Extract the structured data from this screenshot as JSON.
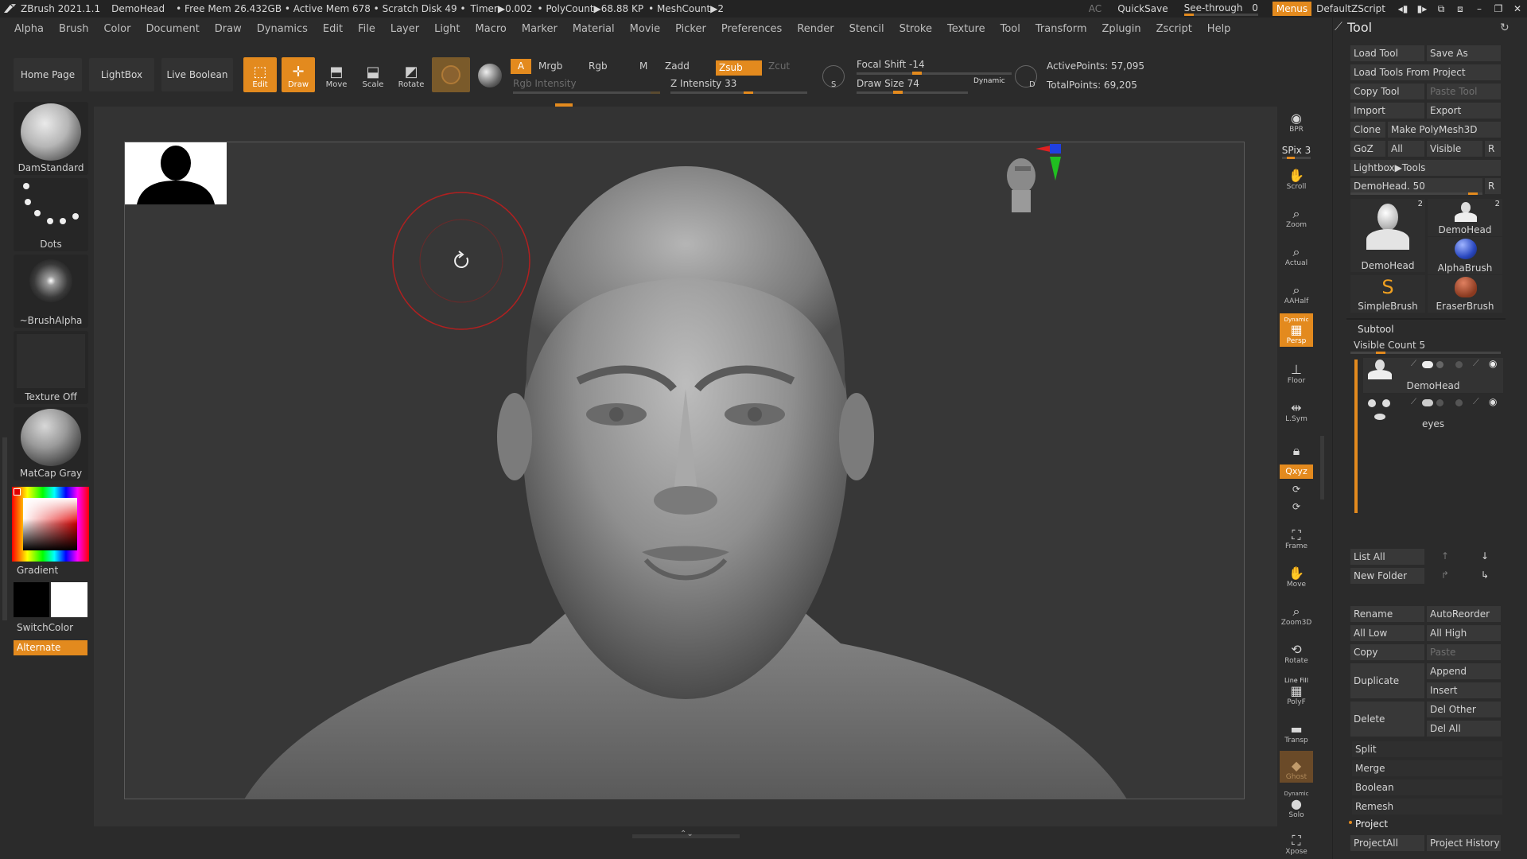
{
  "titlebar": {
    "app": "ZBrush 2021.1.1",
    "doc": "DemoHead",
    "stats": "• Free Mem 26.432GB • Active Mem 678 • Scratch Disk 49 •",
    "timer": "Timer▶0.002",
    "polycount": "• PolyCount▶68.88 KP",
    "meshcount": "• MeshCount▶2",
    "ac": "AC",
    "quicksave": "QuickSave",
    "see_through_label": "See-through",
    "see_through_value": "0",
    "menus": "Menus",
    "script": "DefaultZScript"
  },
  "menu": [
    "Alpha",
    "Brush",
    "Color",
    "Document",
    "Draw",
    "Dynamics",
    "Edit",
    "File",
    "Layer",
    "Light",
    "Macro",
    "Marker",
    "Material",
    "Movie",
    "Picker",
    "Preferences",
    "Render",
    "Stencil",
    "Stroke",
    "Texture",
    "Tool",
    "Transform",
    "Zplugin",
    "Zscript",
    "Help"
  ],
  "shelf": {
    "home_page": "Home Page",
    "lightbox": "LightBox",
    "live_boolean": "Live Boolean",
    "edit": "Edit",
    "draw": "Draw",
    "move": "Move",
    "scale": "Scale",
    "rotate": "Rotate",
    "a": "A",
    "mrgb": "Mrgb",
    "rgb": "Rgb",
    "m": "M",
    "zadd": "Zadd",
    "zsub": "Zsub",
    "zcut": "Zcut",
    "rgb_intensity": "Rgb Intensity",
    "z_intensity": "Z Intensity 33",
    "focal_shift": "Focal Shift -14",
    "draw_size": "Draw Size 74",
    "dynamic": "Dynamic",
    "active_points": "ActivePoints: 57,095",
    "total_points": "TotalPoints: 69,205",
    "s": "S",
    "d": "D",
    "values": {
      "z_intensity": 33,
      "focal_shift": -14,
      "draw_size": 74
    }
  },
  "left": {
    "brush": "DamStandard",
    "stroke": "Dots",
    "alpha": "~BrushAlpha",
    "texture": "Texture Off",
    "material": "MatCap Gray",
    "gradient": "Gradient",
    "switchcolor": "SwitchColor",
    "alternate": "Alternate"
  },
  "rightbar": {
    "bpr": "BPR",
    "spix": "SPix 3",
    "scroll": "Scroll",
    "zoom": "Zoom",
    "actual": "Actual",
    "aahalf": "AAHalf",
    "persp": "Persp",
    "dynamic": "Dynamic",
    "floor": "Floor",
    "lsym": "L.Sym",
    "xyz": "Qxyz",
    "frame": "Frame",
    "move": "Move",
    "zoom3d": "Zoom3D",
    "rotate": "Rotate",
    "linefill": "Line Fill",
    "polyf": "PolyF",
    "transp": "Transp",
    "ghost": "Ghost",
    "solo": "Solo",
    "xpose": "Xpose"
  },
  "tool": {
    "title": "Tool",
    "load_tool": "Load Tool",
    "save_as": "Save As",
    "load_from_project": "Load Tools From Project",
    "copy_tool": "Copy Tool",
    "paste_tool": "Paste Tool",
    "import": "Import",
    "export": "Export",
    "clone": "Clone",
    "make_polymesh": "Make PolyMesh3D",
    "goz": "GoZ",
    "all": "All",
    "visible": "Visible",
    "r": "R",
    "lightbox_tools": "Lightbox▶Tools",
    "demohead_slider": "DemoHead. 50",
    "thumbs": [
      {
        "name": "DemoHead",
        "num": "2"
      },
      {
        "name": "DemoHead",
        "num": "2"
      },
      {
        "name": "AlphaBrush",
        "num": ""
      },
      {
        "name": "SimpleBrush",
        "num": ""
      },
      {
        "name": "EraserBrush",
        "num": ""
      }
    ],
    "subtool": "Subtool",
    "visible_count": "Visible Count 5",
    "subtools": [
      "DemoHead",
      "eyes"
    ],
    "list_all": "List All",
    "new_folder": "New Folder",
    "rename": "Rename",
    "autoreorder": "AutoReorder",
    "all_low": "All Low",
    "all_high": "All High",
    "copy": "Copy",
    "paste": "Paste",
    "duplicate": "Duplicate",
    "append": "Append",
    "insert": "Insert",
    "delete": "Delete",
    "del_other": "Del Other",
    "del_all": "Del All",
    "split": "Split",
    "merge": "Merge",
    "boolean": "Boolean",
    "remesh": "Remesh",
    "project": "Project",
    "project_all": "ProjectAll",
    "project_history": "Project History"
  }
}
